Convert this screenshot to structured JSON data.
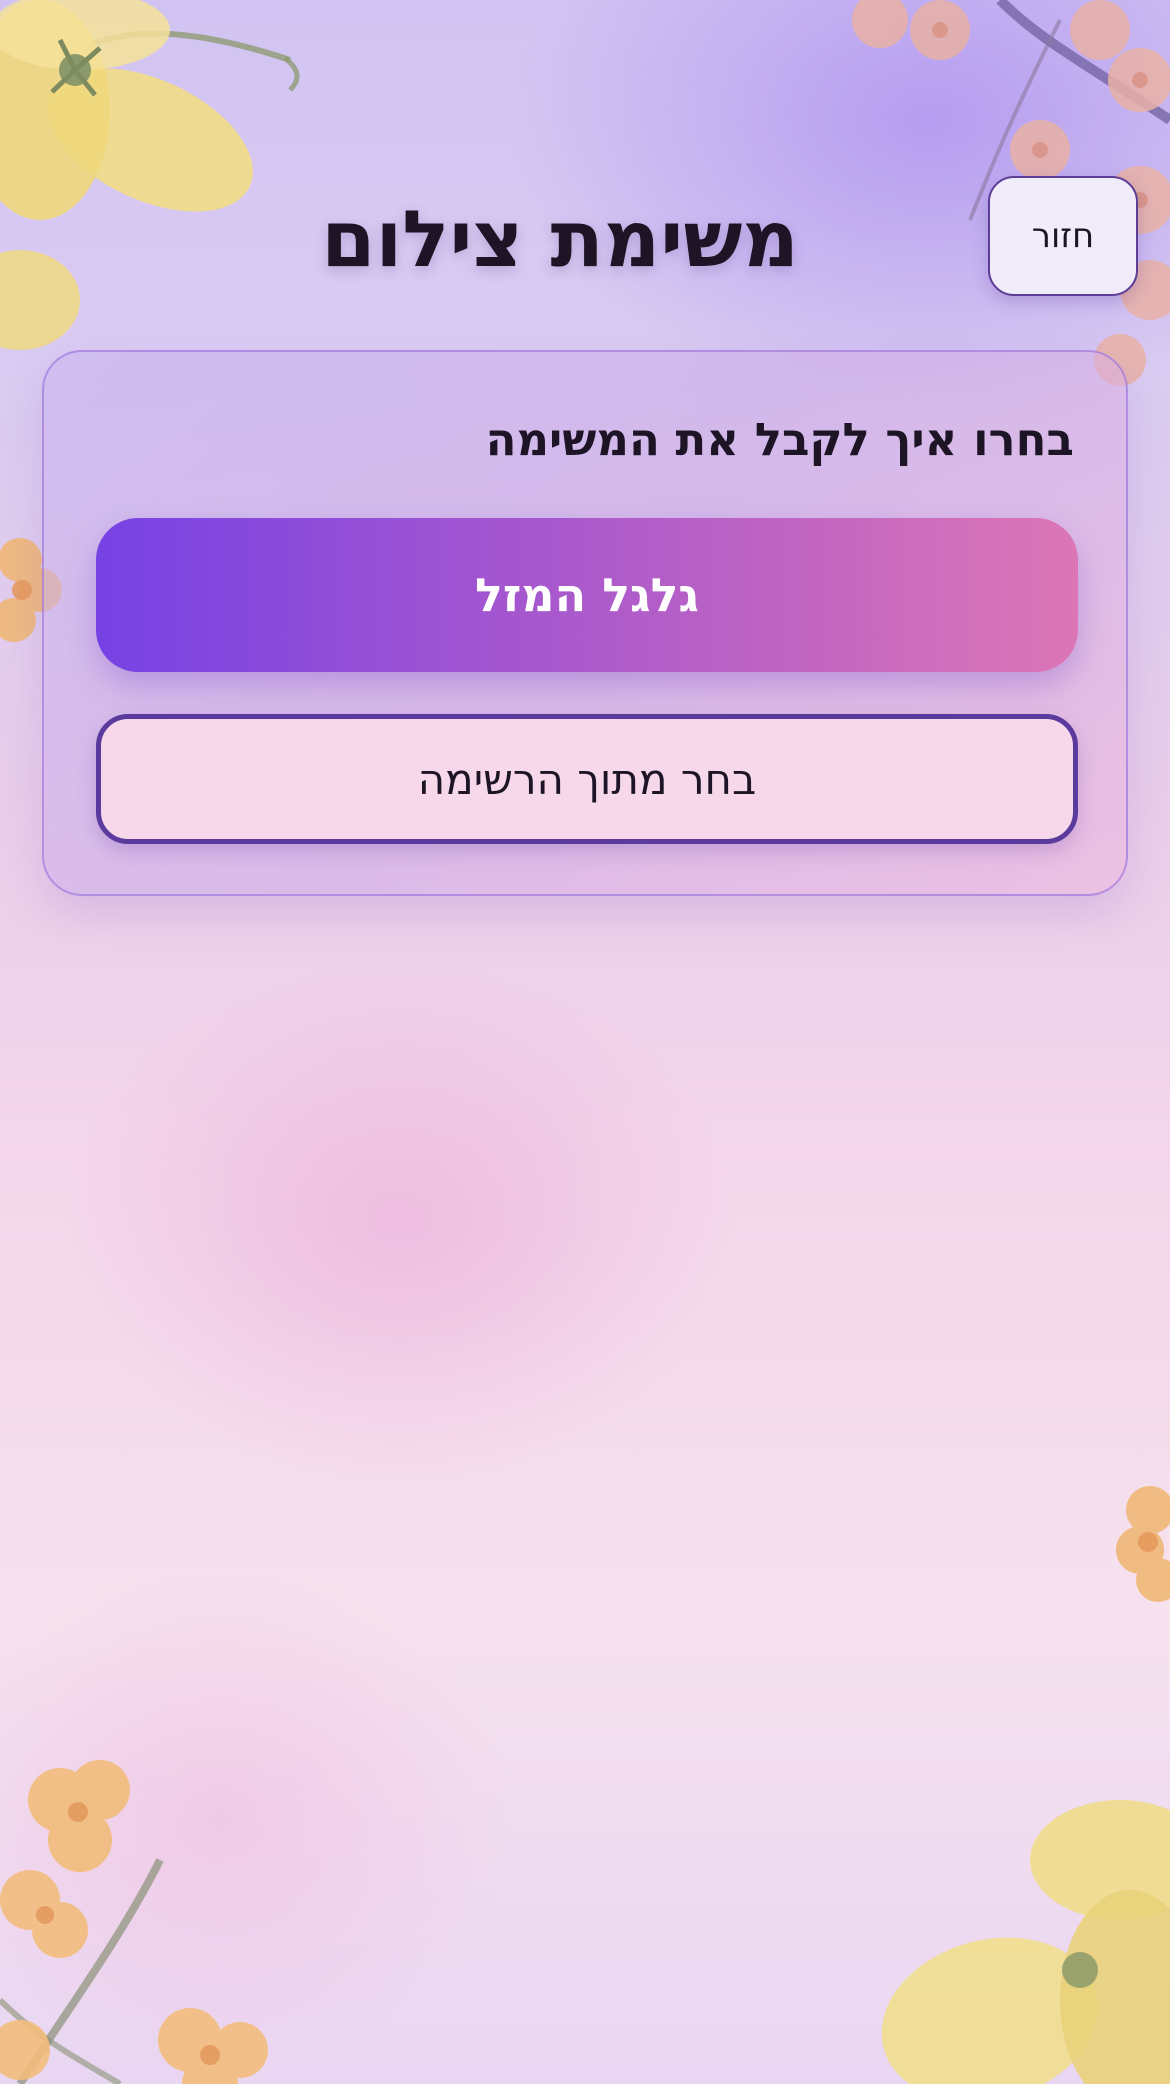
{
  "header": {
    "title": "משימת צילום",
    "back_label": "חזור"
  },
  "card": {
    "prompt": "בחרו איך לקבל את המשימה",
    "wheel_label": "גלגל המזל",
    "list_label": "בחר מתוך הרשימה"
  },
  "colors": {
    "accent_purple": "#7642e4",
    "accent_pink": "#dc76b6",
    "button_border": "#5a3a9c",
    "text_dark": "#1d1525"
  },
  "decorations": [
    "yellow-flower-icon",
    "peach-blossom-icon",
    "cherry-blossom-icon"
  ]
}
